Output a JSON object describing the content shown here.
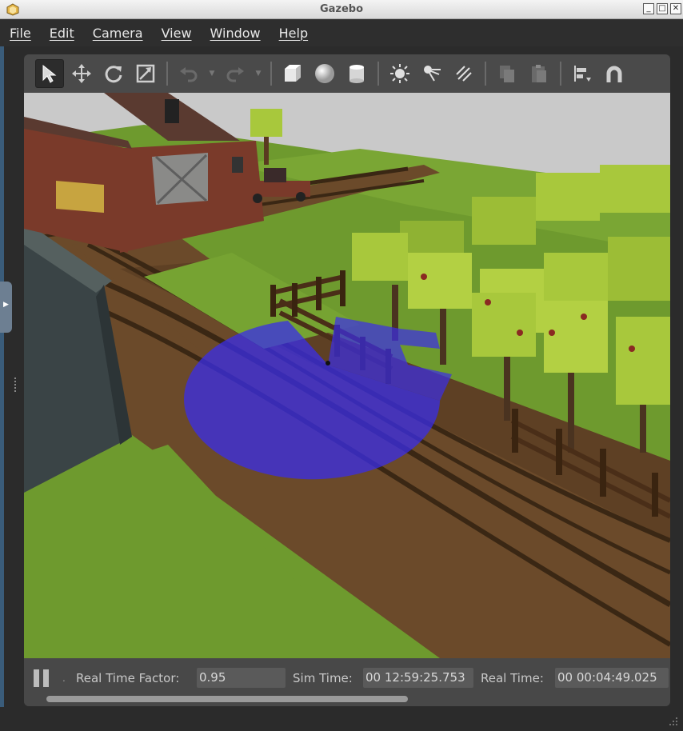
{
  "window": {
    "title": "Gazebo",
    "buttons": [
      "_",
      "□",
      "✕"
    ]
  },
  "menubar": {
    "items": [
      "File",
      "Edit",
      "Camera",
      "View",
      "Window",
      "Help"
    ]
  },
  "toolbar": {
    "tools": [
      "select-arrow-icon",
      "translate-icon",
      "rotate-icon",
      "scale-icon",
      "undo-icon",
      "redo-icon",
      "box-icon",
      "sphere-icon",
      "cylinder-icon",
      "point-light-icon",
      "spot-light-icon",
      "directional-light-icon",
      "copy-icon",
      "paste-icon",
      "align-icon",
      "snap-icon"
    ]
  },
  "status": {
    "real_time_factor_label": "Real Time Factor:",
    "real_time_factor_value": "0.95",
    "sim_time_label": "Sim Time:",
    "sim_time_value": "00 12:59:25.753",
    "real_time_label": "Real Time:",
    "real_time_value": "00 00:04:49.025",
    "separator_dot": "."
  },
  "colors": {
    "grass": "#6b9a2c",
    "dirt_road": "#6b4a2a",
    "laser_scan": "#3a2ee8",
    "tree_foliage": "#a8c83c",
    "barn_red": "#7a3a2a"
  }
}
